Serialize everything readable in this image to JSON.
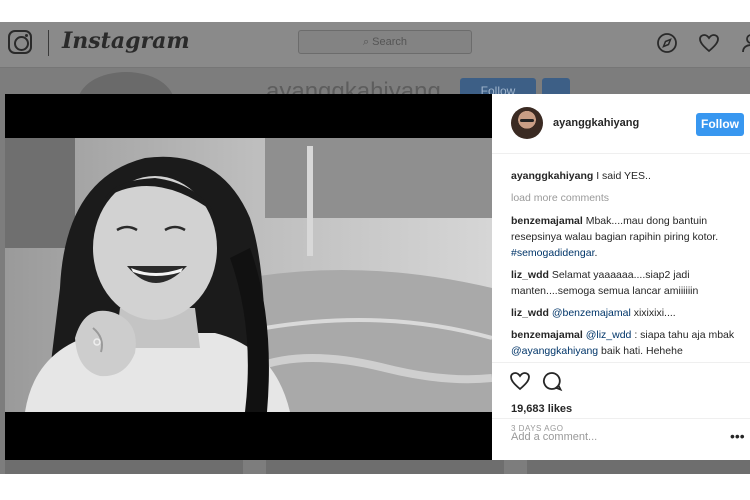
{
  "header": {
    "brand": "Instagram",
    "search_placeholder": "Search"
  },
  "profile": {
    "username": "ayanggkahiyang",
    "follow_label": "Follow"
  },
  "post": {
    "author": "ayanggkahiyang",
    "follow_label": "Follow",
    "caption": "I said YES..",
    "load_more": "load more comments",
    "comments": [
      {
        "user": "benzemajamal",
        "text": "Mbak....mau dong bantuin resepsinya walau bagian rapihin piring kotor.",
        "tag": "#semogadidengar",
        "after": "."
      },
      {
        "user": "liz_wdd",
        "text": "Selamat yaaaaaa....siap2 jadi manten....semoga semua lancar amiiiiiin"
      },
      {
        "user": "liz_wdd",
        "mention": "@benzemajamal",
        "text": " xixixixi...."
      },
      {
        "user": "benzemajamal",
        "mention": "@liz_wdd",
        "text": " : siapa tahu aja mbak ",
        "mention2": "@ayanggkahiyang",
        "text2": " baik hati. Hehehe"
      }
    ],
    "likes": "19,683 likes",
    "time": "3 DAYS AGO",
    "add_comment_placeholder": "Add a comment...",
    "more_label": "•••"
  },
  "icons": [
    "instagram-icon",
    "compass-icon",
    "heart-icon",
    "person-icon",
    "comment-icon",
    "search-icon"
  ]
}
